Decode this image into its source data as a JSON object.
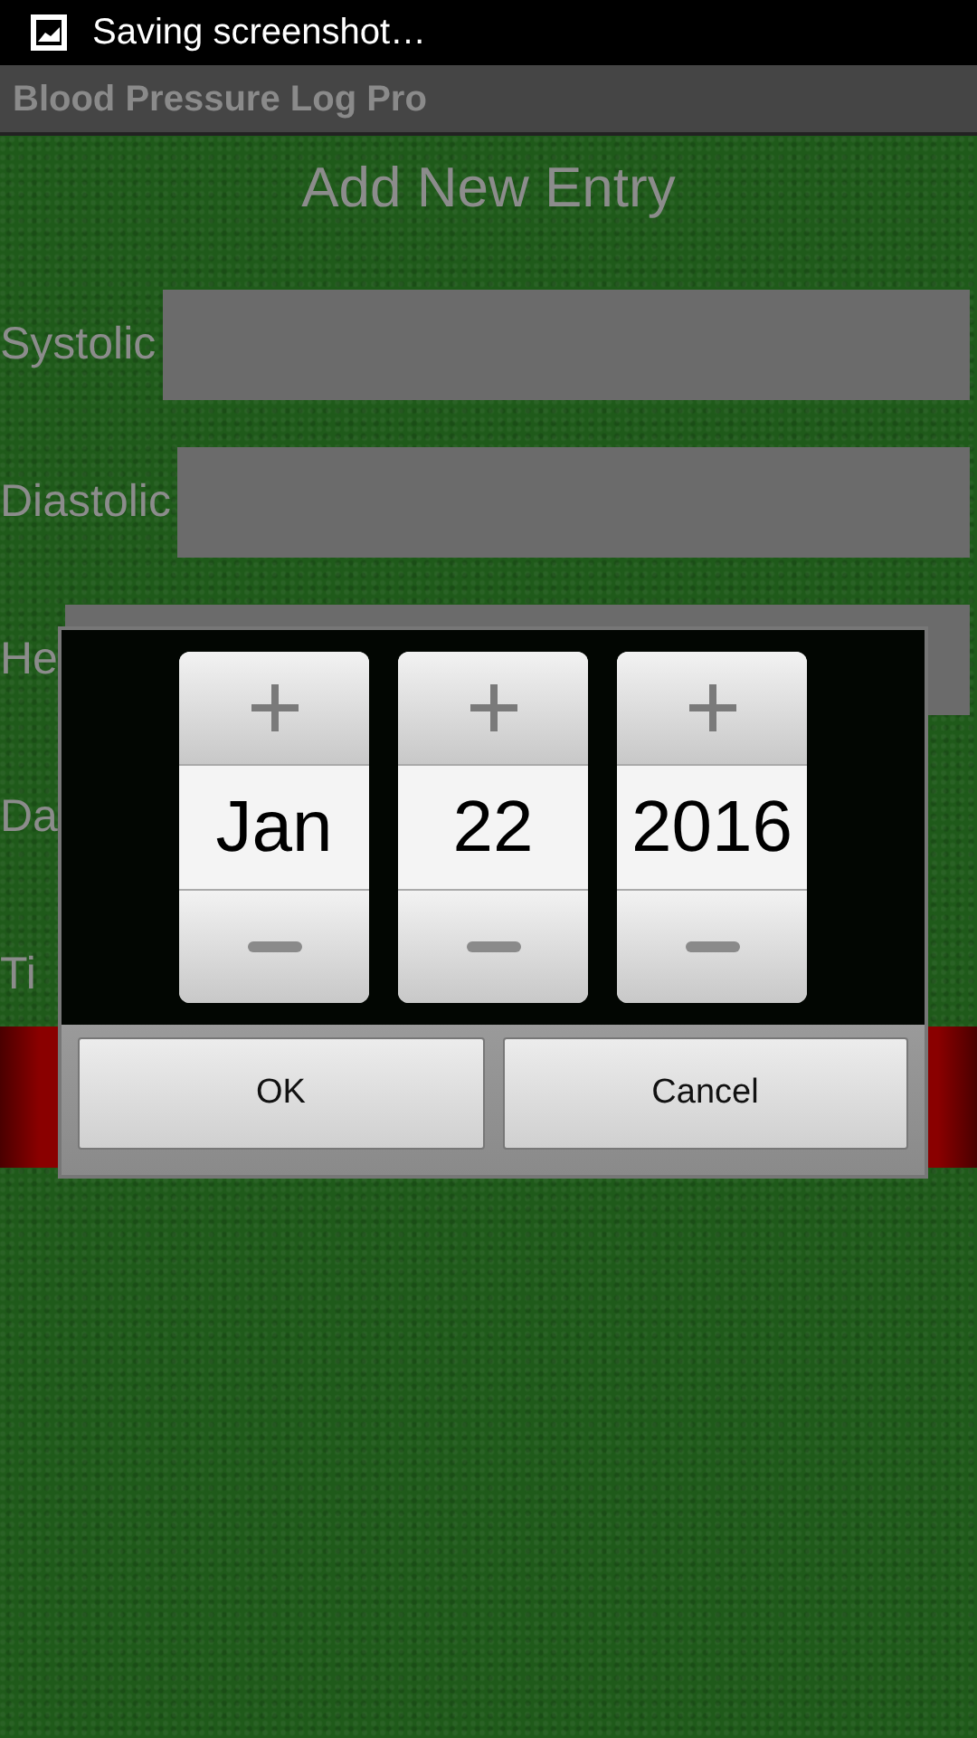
{
  "status_bar": {
    "notification": "Saving screenshot…"
  },
  "app_title": "Blood Pressure Log Pro",
  "heading": "Add New Entry",
  "fields": [
    {
      "label": "Systolic",
      "kind": "input"
    },
    {
      "label": "Diastolic",
      "kind": "input"
    },
    {
      "label": "He",
      "kind": "input"
    },
    {
      "label": "Da",
      "kind": "text"
    },
    {
      "label": "Ti",
      "kind": "text"
    }
  ],
  "date_picker": {
    "columns": [
      {
        "value": "Jan"
      },
      {
        "value": "22"
      },
      {
        "value": "2016"
      }
    ],
    "buttons": [
      "OK",
      "Cancel"
    ]
  }
}
